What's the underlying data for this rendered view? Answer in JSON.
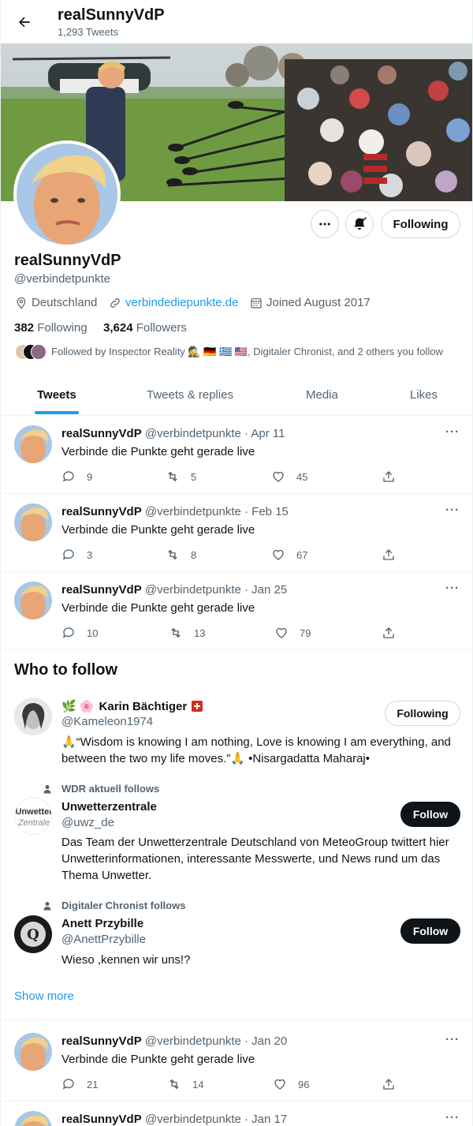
{
  "header": {
    "title": "realSunnyVdP",
    "tweet_count": "1,293 Tweets"
  },
  "profile": {
    "name": "realSunnyVdP",
    "handle": "@verbindetpunkte",
    "location": "Deutschland",
    "website": "verbindediepunkte.de",
    "joined": "Joined August 2017",
    "following_count": "382",
    "following_label": "Following",
    "followers_count": "3,624",
    "followers_label": "Followers",
    "followed_by": "Followed by Inspector Reality 🕵 🇩🇪 🇬🇷 🇺🇸, Digitaler Chronist, and 2 others you follow",
    "follow_state": "Following"
  },
  "tabs": [
    {
      "label": "Tweets",
      "active": true
    },
    {
      "label": "Tweets & replies",
      "active": false
    },
    {
      "label": "Media",
      "active": false
    },
    {
      "label": "Likes",
      "active": false
    }
  ],
  "tweets": [
    {
      "name": "realSunnyVdP",
      "meta": "@verbindetpunkte · Apr 11",
      "text": "Verbinde die Punkte geht gerade live",
      "replies": "9",
      "retweets": "5",
      "likes": "45"
    },
    {
      "name": "realSunnyVdP",
      "meta": "@verbindetpunkte · Feb 15",
      "text": "Verbinde die Punkte geht gerade live",
      "replies": "3",
      "retweets": "8",
      "likes": "67"
    },
    {
      "name": "realSunnyVdP",
      "meta": "@verbindetpunkte · Jan 25",
      "text": "Verbinde die Punkte geht gerade live",
      "replies": "10",
      "retweets": "13",
      "likes": "79"
    },
    {
      "name": "realSunnyVdP",
      "meta": "@verbindetpunkte · Jan 20",
      "text": "Verbinde die Punkte geht gerade live",
      "replies": "21",
      "retweets": "14",
      "likes": "96"
    },
    {
      "name": "realSunnyVdP",
      "meta": "@verbindetpunkte · Jan 17"
    }
  ],
  "who_to_follow": {
    "title": "Who to follow",
    "show_more": "Show more",
    "users": [
      {
        "emoji": "🌿 🌸",
        "name": "Karin Bächtiger",
        "handle": "@Kameleon1974",
        "bio": "🙏“Wisdom is knowing I am nothing, Love is knowing I am everything, and between the two my life moves.”🙏 •Nisargadatta Maharaj•",
        "button": "Following"
      },
      {
        "context": "WDR aktuell follows",
        "name": "Unwetterzentrale",
        "handle": "@uwz_de",
        "bio": "Das Team der Unwetterzentrale Deutschland von MeteoGroup twittert hier Unwetterinformationen, interessante Messwerte, und News rund um das Thema Unwetter.",
        "button": "Follow",
        "avatar_text_1": "Unwetter",
        "avatar_text_2": "Zentrale"
      },
      {
        "context": "Digitaler Chronist follows",
        "name": "Anett Przybille",
        "handle": "@AnettPrzybille",
        "bio": "Wieso ,kennen wir uns!?",
        "button": "Follow",
        "avatar_text_1": "Q"
      }
    ]
  },
  "colors": {
    "accent": "#1d9bf0",
    "text": "#0f1419",
    "muted": "#536471",
    "border": "#eff3f4"
  }
}
